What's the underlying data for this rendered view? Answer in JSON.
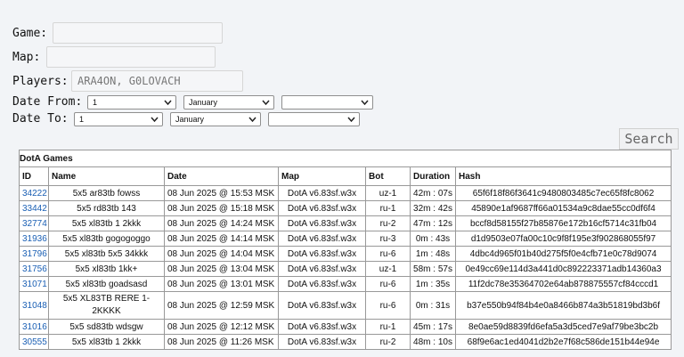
{
  "form": {
    "game_label": "Game:",
    "game_value": "",
    "map_label": "Map:",
    "map_value": "",
    "players_label": "Players:",
    "players_value": "ARA4ON, G0LOVACH",
    "date_from_label": "Date From:",
    "date_to_label": "Date To:",
    "from_day": "1",
    "from_month": "January",
    "from_year": "",
    "to_day": "1",
    "to_month": "January",
    "to_year": "",
    "search_label": "Search"
  },
  "table": {
    "caption": "DotA Games",
    "headers": [
      "ID",
      "Name",
      "Date",
      "Map",
      "Bot",
      "Duration",
      "Hash"
    ],
    "rows": [
      {
        "id": "34222",
        "name": "5x5 ar83tb fowss",
        "date": "08 Jun 2025 @ 15:53 MSK",
        "map": "DotA v6.83sf.w3x",
        "bot": "uz-1",
        "duration": "42m : 07s",
        "hash": "65f6f18f86f3641c9480803485c7ec65f8fc8062"
      },
      {
        "id": "33442",
        "name": "5x5 rd83tb 143",
        "date": "08 Jun 2025 @ 15:18 MSK",
        "map": "DotA v6.83sf.w3x",
        "bot": "ru-1",
        "duration": "32m : 42s",
        "hash": "45890e1af9687ff66a01534a9c8dae55cc0df6f4"
      },
      {
        "id": "32774",
        "name": "5x5 xl83tb 1 2kkk",
        "date": "08 Jun 2025 @ 14:24 MSK",
        "map": "DotA v6.83sf.w3x",
        "bot": "ru-2",
        "duration": "47m : 12s",
        "hash": "bccf8d58155f27b85876e172b16cf5714c31fb04"
      },
      {
        "id": "31936",
        "name": "5x5 xl83tb gogogoggo",
        "date": "08 Jun 2025 @ 14:14 MSK",
        "map": "DotA v6.83sf.w3x",
        "bot": "ru-3",
        "duration": "0m : 43s",
        "hash": "d1d9503e07fa00c10c9f8f195e3f902868055f97"
      },
      {
        "id": "31796",
        "name": "5x5 xl83tb 5x5 34kkk",
        "date": "08 Jun 2025 @ 14:04 MSK",
        "map": "DotA v6.83sf.w3x",
        "bot": "ru-6",
        "duration": "1m : 48s",
        "hash": "4dbc4d965f01b40d275f5f0e4cfb71e0c78d9074"
      },
      {
        "id": "31756",
        "name": "5x5 xl83tb 1kk+",
        "date": "08 Jun 2025 @ 13:04 MSK",
        "map": "DotA v6.83sf.w3x",
        "bot": "uz-1",
        "duration": "58m : 57s",
        "hash": "0e49cc69e114d3a441d0c892223371adb14360a3"
      },
      {
        "id": "31071",
        "name": "5x5 xl83tb goadsasd",
        "date": "08 Jun 2025 @ 13:01 MSK",
        "map": "DotA v6.83sf.w3x",
        "bot": "ru-6",
        "duration": "1m : 35s",
        "hash": "11f2dc78e35364702e64ab878875557cf84cccd1"
      },
      {
        "id": "31048",
        "name": "5x5 XL83TB RERE 1-2KKKK",
        "date": "08 Jun 2025 @ 12:59 MSK",
        "map": "DotA v6.83sf.w3x",
        "bot": "ru-6",
        "duration": "0m : 31s",
        "hash": "b37e550b94f84b4e0a8466b874a3b51819bd3b6f"
      },
      {
        "id": "31016",
        "name": "5x5 sd83tb wdsgw",
        "date": "08 Jun 2025 @ 12:12 MSK",
        "map": "DotA v6.83sf.w3x",
        "bot": "ru-1",
        "duration": "45m : 17s",
        "hash": "8e0ae59d8839fd6efa5a3d5ced7e9af79be3bc2b"
      },
      {
        "id": "30555",
        "name": "5x5 xl83tb 1 2kkk",
        "date": "08 Jun 2025 @ 11:26 MSK",
        "map": "DotA v6.83sf.w3x",
        "bot": "ru-2",
        "duration": "48m : 10s",
        "hash": "68f9e6ac1ed4041d2b2e7f68c586de151b44e94e"
      }
    ]
  },
  "colors": {
    "link": "#1a5fb4",
    "background": "#f2f4f7"
  }
}
